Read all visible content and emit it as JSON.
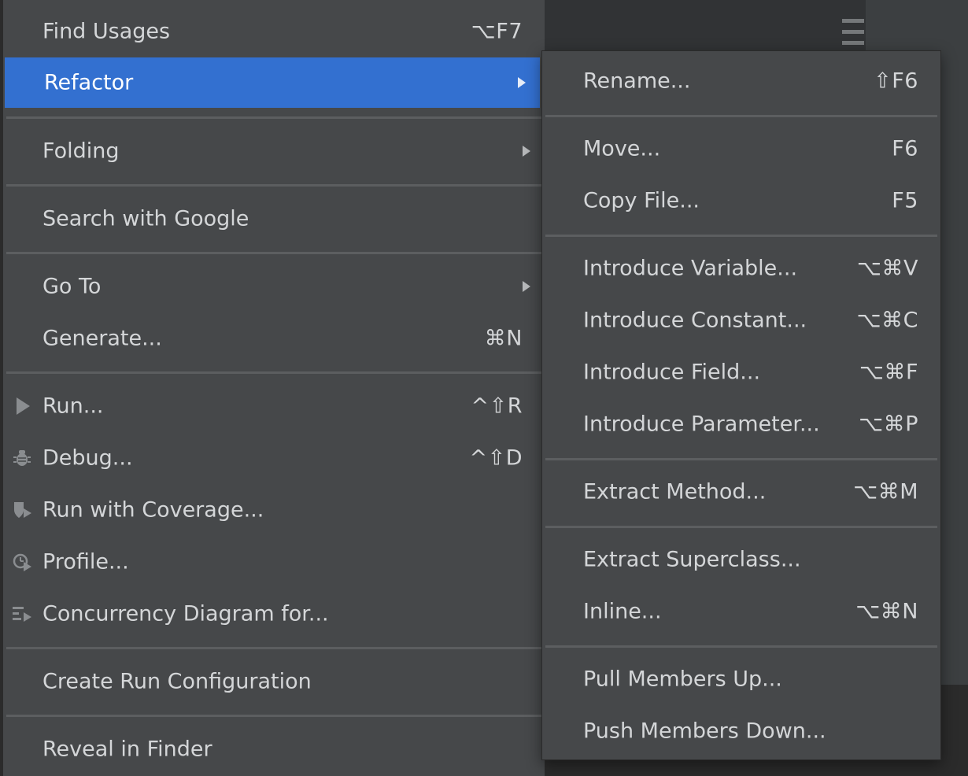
{
  "main_menu": {
    "find_usages": {
      "label": "Find Usages",
      "shortcut": "⌥F7"
    },
    "refactor": {
      "label": "Refactor"
    },
    "folding": {
      "label": "Folding"
    },
    "search_google": {
      "label": "Search with Google"
    },
    "go_to": {
      "label": "Go To"
    },
    "generate": {
      "label": "Generate...",
      "shortcut": "⌘N"
    },
    "run": {
      "label": "Run...",
      "shortcut": "^⇧R",
      "icon": "run-icon"
    },
    "debug": {
      "label": "Debug...",
      "shortcut": "^⇧D",
      "icon": "bug-icon"
    },
    "coverage": {
      "label": "Run with Coverage...",
      "icon": "coverage-icon"
    },
    "profile": {
      "label": "Profile...",
      "icon": "profile-icon"
    },
    "concurrency": {
      "label": "Concurrency Diagram for...",
      "icon": "concurrency-icon"
    },
    "create_run_config": {
      "label": "Create Run Configuration"
    },
    "reveal_finder": {
      "label": "Reveal in Finder"
    }
  },
  "refactor_menu": {
    "rename": {
      "label": "Rename...",
      "shortcut": "⇧F6"
    },
    "move": {
      "label": "Move...",
      "shortcut": "F6"
    },
    "copy_file": {
      "label": "Copy File...",
      "shortcut": "F5"
    },
    "introduce_variable": {
      "label": "Introduce Variable...",
      "shortcut": "⌥⌘V"
    },
    "introduce_constant": {
      "label": "Introduce Constant...",
      "shortcut": "⌥⌘C"
    },
    "introduce_field": {
      "label": "Introduce Field...",
      "shortcut": "⌥⌘F"
    },
    "introduce_parameter": {
      "label": "Introduce Parameter...",
      "shortcut": "⌥⌘P"
    },
    "extract_method": {
      "label": "Extract Method...",
      "shortcut": "⌥⌘M"
    },
    "extract_superclass": {
      "label": "Extract Superclass..."
    },
    "inline": {
      "label": "Inline...",
      "shortcut": "⌥⌘N"
    },
    "pull_members_up": {
      "label": "Pull Members Up..."
    },
    "push_members_down": {
      "label": "Push Members Down..."
    }
  },
  "colors": {
    "menu_bg": "#46484a",
    "selection": "#3370d0",
    "text": "#d4d6d8",
    "separator": "#5c5e60"
  }
}
